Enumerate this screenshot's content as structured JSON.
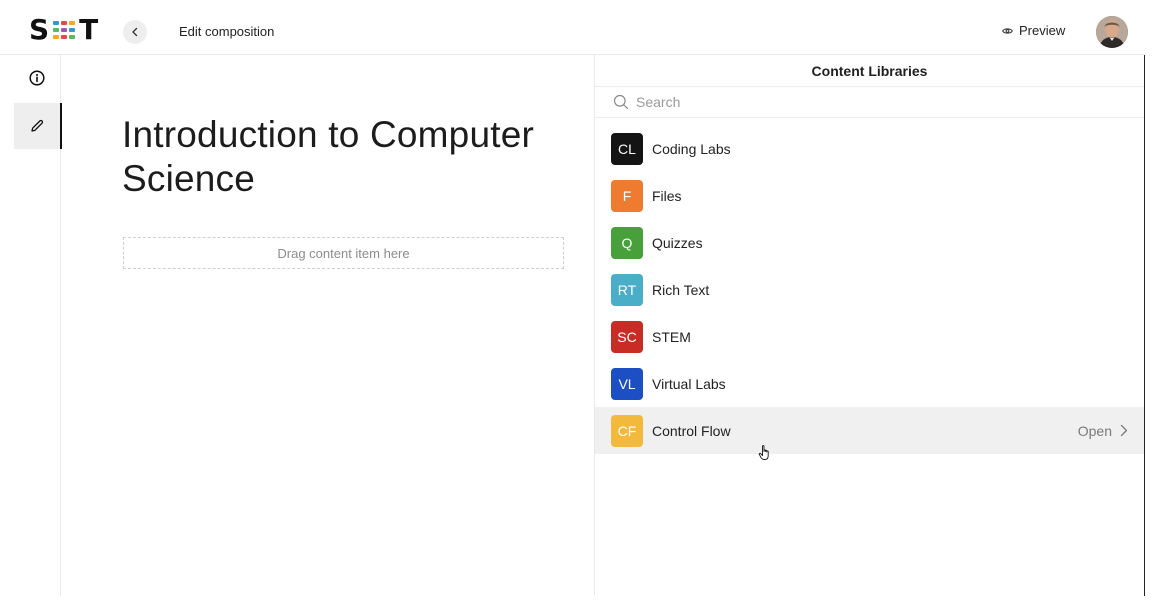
{
  "header": {
    "logo": {
      "letters": [
        "S",
        "T"
      ],
      "dot_colors": [
        "#2e9bd6",
        "#e9484b",
        "#f5a623",
        "#5bb85d",
        "#9b59b6",
        "#2e9bd6",
        "#f5a623",
        "#e9484b",
        "#5bb85d"
      ]
    },
    "back_icon": "chevron-left-icon",
    "title": "Edit composition",
    "preview_label": "Preview",
    "preview_icon": "eye-icon"
  },
  "rail": {
    "items": [
      {
        "icon": "info-icon",
        "active": false
      },
      {
        "icon": "pencil-icon",
        "active": true
      }
    ]
  },
  "main": {
    "title": "Introduction to Computer Science",
    "dropzone_text": "Drag content item here"
  },
  "panel": {
    "title": "Content Libraries",
    "search_placeholder": "Search",
    "libraries": [
      {
        "abbr": "CL",
        "label": "Coding Labs",
        "color": "#141414"
      },
      {
        "abbr": "F",
        "label": "Files",
        "color": "#ee7b2f"
      },
      {
        "abbr": "Q",
        "label": "Quizzes",
        "color": "#47a03a"
      },
      {
        "abbr": "RT",
        "label": "Rich Text",
        "color": "#4aaec9"
      },
      {
        "abbr": "SC",
        "label": "STEM",
        "color": "#c92c24"
      },
      {
        "abbr": "VL",
        "label": "Virtual Labs",
        "color": "#1c4fc4"
      },
      {
        "abbr": "CF",
        "label": "Control Flow",
        "color": "#f3b93c",
        "hovered": true,
        "action": "Open"
      }
    ]
  },
  "colors": {
    "accent": "#111111",
    "hover_bg": "#f0f0f0",
    "border": "#e9e9e9"
  }
}
